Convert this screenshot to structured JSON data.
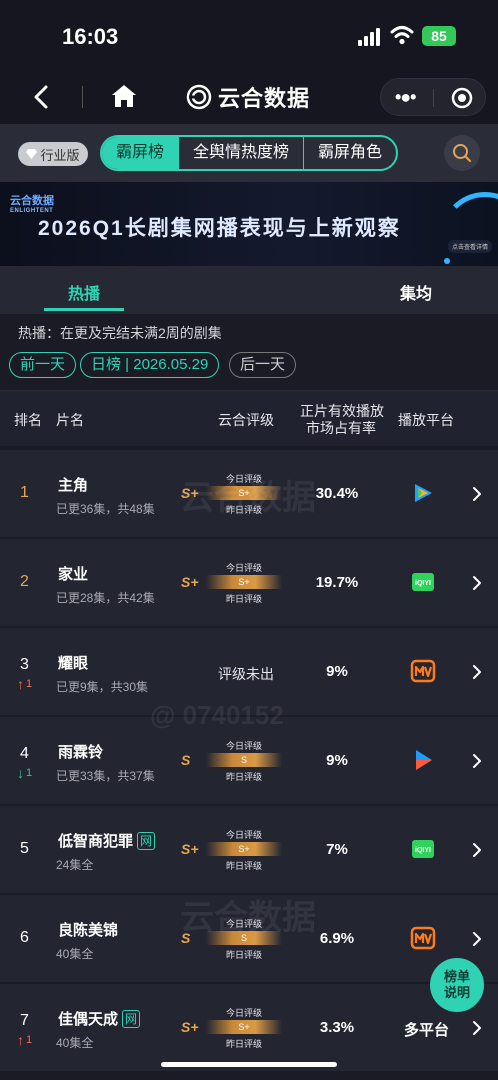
{
  "status_bar": {
    "time": "16:03",
    "battery": "85"
  },
  "nav": {
    "title": "云合数据"
  },
  "tabs": {
    "industry_badge": "行业版",
    "segments": [
      "霸屏榜",
      "全舆情热度榜",
      "霸屏角色"
    ],
    "active_segment": "霸屏榜"
  },
  "banner": {
    "title": "2026Q1长剧集网播表现与上新观察",
    "logo_text": "云合数据",
    "logo_sub": "ENLIGHTENT",
    "tag": "点击查看详情"
  },
  "sub_tabs": {
    "left": "热播",
    "middle": "",
    "right": "集均"
  },
  "description": "热播：在更及完结未满2周的剧集",
  "date_nav": {
    "prev": "前一天",
    "current": "日榜 | 2026.05.29",
    "next": "后一天"
  },
  "table_headers": {
    "rank": "排名",
    "title": "片名",
    "rating": "云合评级",
    "share_line1": "正片有效播放",
    "share_line2": "市场占有率",
    "platform": "播放平台"
  },
  "rating_labels": {
    "today": "今日评级",
    "yesterday": "昨日评级",
    "not_out": "评级未出"
  },
  "rows": [
    {
      "rank": "1",
      "title": "主角",
      "episodes": "已更36集，共48集",
      "grade": "S+",
      "bar_grade": "S+",
      "share": "30.4%",
      "platform": "tencent-video",
      "change": "",
      "change_dir": "",
      "net": false
    },
    {
      "rank": "2",
      "title": "家业",
      "episodes": "已更28集，共42集",
      "grade": "S+",
      "bar_grade": "S+",
      "share": "19.7%",
      "platform": "iqiyi",
      "change": "",
      "change_dir": "",
      "net": false
    },
    {
      "rank": "3",
      "title": "耀眼",
      "episodes": "已更9集，共30集",
      "grade": "",
      "bar_grade": "",
      "share": "9%",
      "platform": "mango-tv",
      "change": "1",
      "change_dir": "up",
      "net": false
    },
    {
      "rank": "4",
      "title": "雨霖铃",
      "episodes": "已更33集，共37集",
      "grade": "S",
      "bar_grade": "S",
      "share": "9%",
      "platform": "youku",
      "change": "1",
      "change_dir": "down",
      "net": false
    },
    {
      "rank": "5",
      "title": "低智商犯罪",
      "episodes": "24集全",
      "grade": "S+",
      "bar_grade": "S+",
      "share": "7%",
      "platform": "iqiyi",
      "change": "",
      "change_dir": "",
      "net": true
    },
    {
      "rank": "6",
      "title": "良陈美锦",
      "episodes": "40集全",
      "grade": "S",
      "bar_grade": "S",
      "share": "6.9%",
      "platform": "mango-tv",
      "change": "",
      "change_dir": "",
      "net": false
    },
    {
      "rank": "7",
      "title": "佳偶天成",
      "episodes": "40集全",
      "grade": "S+",
      "bar_grade": "S+",
      "share": "3.3%",
      "platform": "多平台",
      "change": "1",
      "change_dir": "up",
      "net": true
    }
  ],
  "net_badge": "网",
  "fab": {
    "line1": "榜单",
    "line2": "说明"
  },
  "watermark": {
    "brand": "云合数据",
    "brand_en": "ENLIGHTENT",
    "id": "@ 0740152"
  },
  "colors": {
    "accent": "#2fd3b4",
    "gold": "#e8a650",
    "up": "#ff6a4a",
    "down": "#37c58b",
    "bg": "#1a1b25"
  }
}
